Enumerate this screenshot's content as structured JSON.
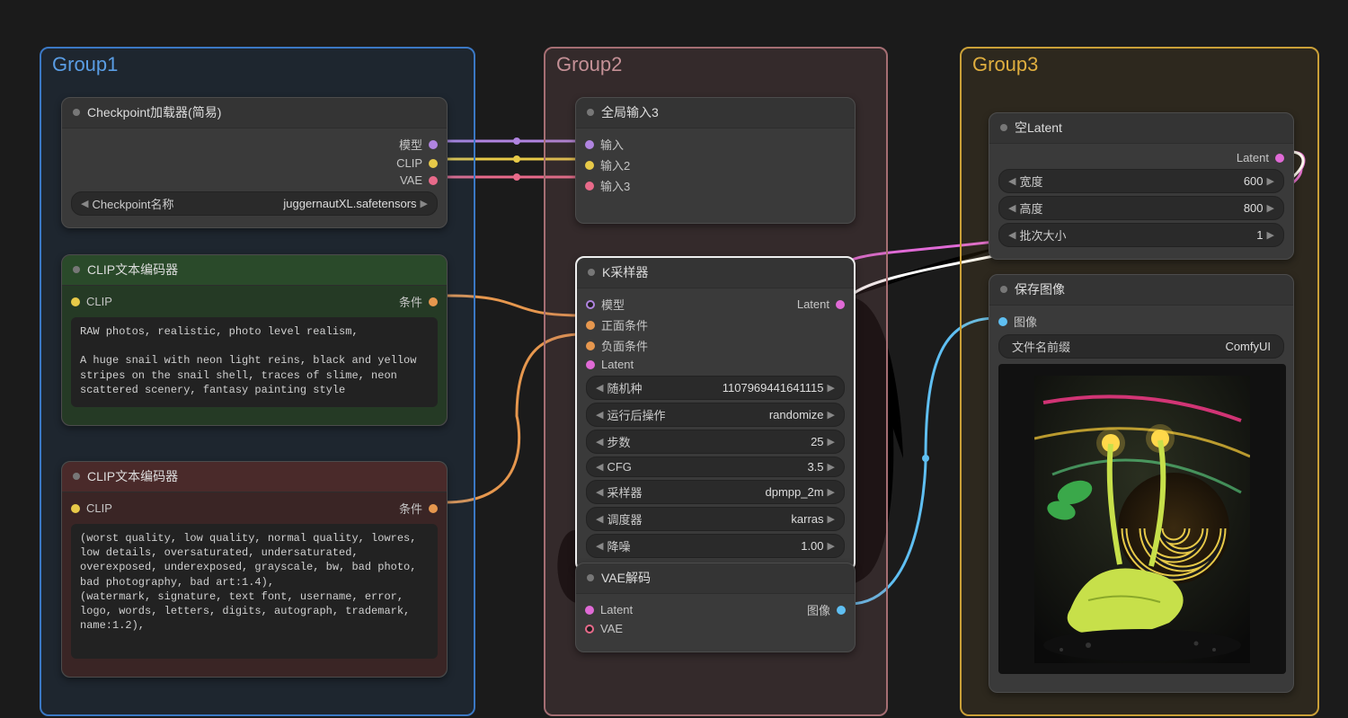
{
  "groups": {
    "g1": {
      "label": "Group1"
    },
    "g2": {
      "label": "Group2"
    },
    "g3": {
      "label": "Group3"
    }
  },
  "checkpoint": {
    "title": "Checkpoint加载器(简易)",
    "out_model": "模型",
    "out_clip": "CLIP",
    "out_vae": "VAE",
    "ckpt_label": "Checkpoint名称",
    "ckpt_value": "juggernautXL.safetensors"
  },
  "clip_pos": {
    "title": "CLIP文本编码器",
    "in_clip": "CLIP",
    "out_cond": "条件",
    "text": "RAW photos, realistic, photo level realism,\n\nA huge snail with neon light reins, black and yellow stripes on the snail shell, traces of slime, neon scattered scenery, fantasy painting style"
  },
  "clip_neg": {
    "title": "CLIP文本编码器",
    "in_clip": "CLIP",
    "out_cond": "条件",
    "text": "(worst quality, low quality, normal quality, lowres, low details, oversaturated, undersaturated, overexposed, underexposed, grayscale, bw, bad photo, bad photography, bad art:1.4),\n(watermark, signature, text font, username, error, logo, words, letters, digits, autograph, trademark, name:1.2),"
  },
  "global_in": {
    "title": "全局输入3",
    "in1": "输入",
    "in2": "输入2",
    "in3": "输入3"
  },
  "ksampler": {
    "title": "K采样器",
    "in_model": "模型",
    "in_pos": "正面条件",
    "in_neg": "负面条件",
    "in_latent": "Latent",
    "out_latent": "Latent",
    "seed_label": "随机种",
    "seed_value": "1107969441641115",
    "after_label": "运行后操作",
    "after_value": "randomize",
    "steps_label": "步数",
    "steps_value": "25",
    "cfg_label": "CFG",
    "cfg_value": "3.5",
    "sampler_label": "采样器",
    "sampler_value": "dpmpp_2m",
    "sched_label": "调度器",
    "sched_value": "karras",
    "denoise_label": "降噪",
    "denoise_value": "1.00"
  },
  "vae_decode": {
    "title": "VAE解码",
    "in_latent": "Latent",
    "in_vae": "VAE",
    "out_image": "图像"
  },
  "empty_latent": {
    "title": "空Latent",
    "out_latent": "Latent",
    "w_label": "宽度",
    "w_value": "600",
    "h_label": "高度",
    "h_value": "800",
    "b_label": "批次大小",
    "b_value": "1"
  },
  "save_image": {
    "title": "保存图像",
    "in_image": "图像",
    "prefix_label": "文件名前缀",
    "prefix_value": "ComfyUI"
  }
}
